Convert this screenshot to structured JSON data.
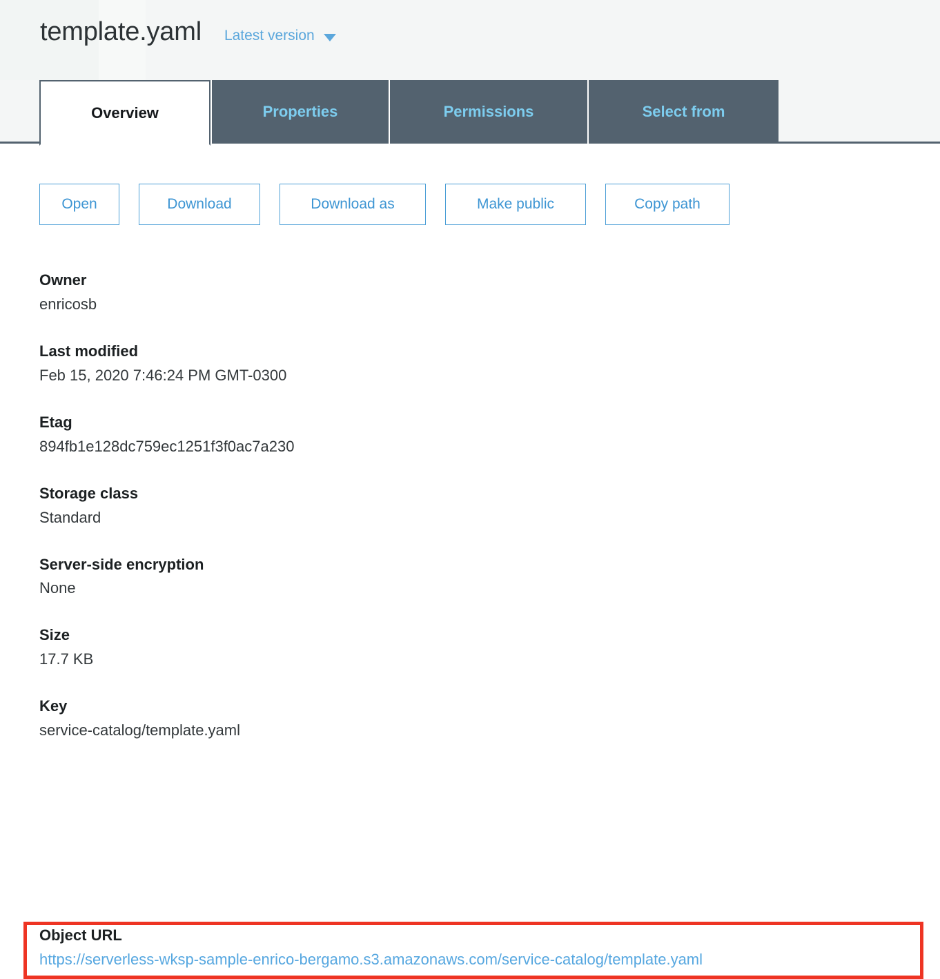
{
  "header": {
    "file_title": "template.yaml",
    "version_label": "Latest version",
    "version_caret_icon": "chevron-down-icon"
  },
  "tabs": [
    {
      "label": "Overview",
      "active": true
    },
    {
      "label": "Properties",
      "active": false
    },
    {
      "label": "Permissions",
      "active": false
    },
    {
      "label": "Select from",
      "active": false
    }
  ],
  "actions": [
    {
      "label": "Open"
    },
    {
      "label": "Download"
    },
    {
      "label": "Download as"
    },
    {
      "label": "Make public"
    },
    {
      "label": "Copy path"
    }
  ],
  "fields": [
    {
      "label": "Owner",
      "value": "enricosb"
    },
    {
      "label": "Last modified",
      "value": "Feb 15, 2020 7:46:24 PM GMT-0300"
    },
    {
      "label": "Etag",
      "value": "894fb1e128dc759ec1251f3f0ac7a230"
    },
    {
      "label": "Storage class",
      "value": "Standard"
    },
    {
      "label": "Server-side encryption",
      "value": "None"
    },
    {
      "label": "Size",
      "value": "17.7 KB"
    },
    {
      "label": "Key",
      "value": "service-catalog/template.yaml"
    }
  ],
  "object_url": {
    "label": "Object URL",
    "value": "https://serverless-wksp-sample-enrico-bergamo.s3.amazonaws.com/service-catalog/template.yaml"
  },
  "colors": {
    "tab_inactive_bg": "#53626f",
    "tab_inactive_text": "#7dcdef",
    "tab_active_bg": "#ffffff",
    "tab_active_text": "#16191c",
    "link_blue": "#56a7e0",
    "button_blue": "#3d95d3",
    "highlight_red": "#ee3423",
    "header_bg": "#f4f6f6",
    "body_text": "#33383b",
    "label_text": "#1c2022"
  }
}
